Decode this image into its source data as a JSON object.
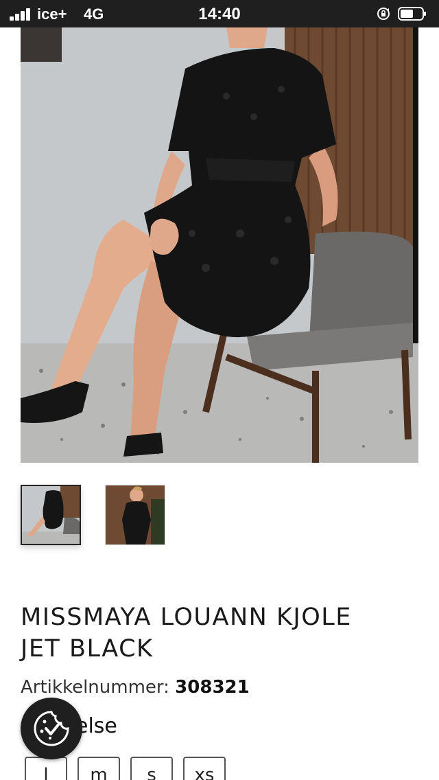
{
  "status_bar": {
    "carrier": "ice+",
    "network": "4G",
    "time": "14:40",
    "icons": [
      "signal-icon",
      "rotation-lock-icon",
      "battery-icon"
    ]
  },
  "gallery": {
    "main_image_alt": "Woman seated on grey chair wearing black jacquard dress",
    "thumbnails": [
      "thumbnail-1",
      "thumbnail-2"
    ]
  },
  "product": {
    "title_line1": "MISSMAYA LOUANN KJOLE",
    "title_line2": "JET BLACK",
    "sku_label": "Artikkelnummer:",
    "sku_value": "308321",
    "size_label": "else",
    "sizes": [
      "l",
      "m",
      "s",
      "xs"
    ]
  },
  "cookie_button": {
    "icon": "cookie-check-icon"
  },
  "colors": {
    "status_bar": "#1f1f1f",
    "text": "#1a1a1a",
    "accent": "#1f1f1f"
  }
}
